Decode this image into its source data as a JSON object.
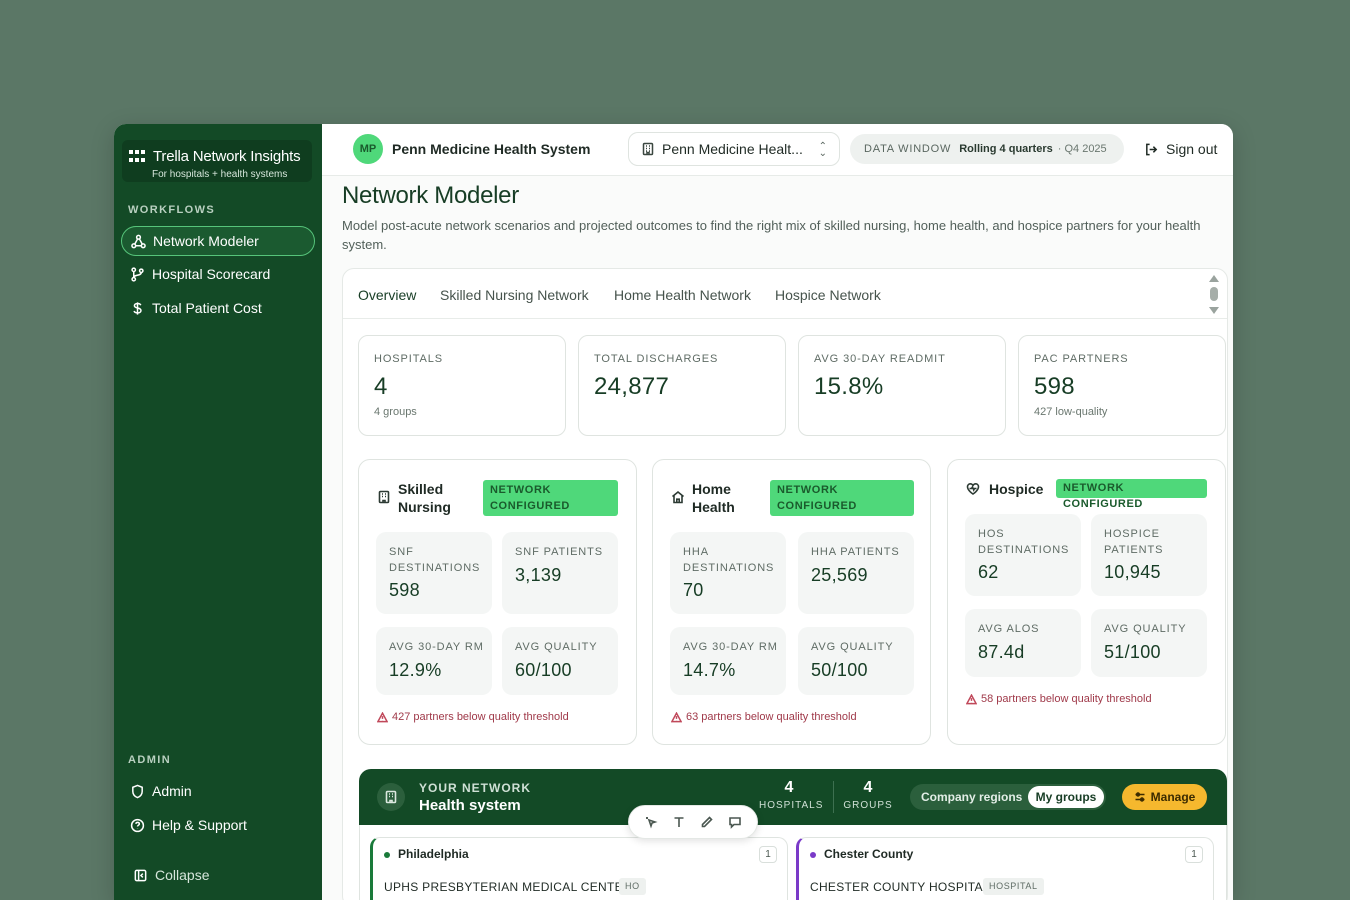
{
  "app": {
    "brand_title": "Trella Network Insights",
    "brand_subtitle": "For hospitals + health systems"
  },
  "sidebar": {
    "workflows_label": "WORKFLOWS",
    "items": [
      {
        "label": "Network Modeler",
        "icon": "network-icon",
        "active": true
      },
      {
        "label": "Hospital Scorecard",
        "icon": "branch-icon",
        "active": false
      },
      {
        "label": "Total Patient Cost",
        "icon": "dollar-icon",
        "active": false
      }
    ],
    "admin_label": "ADMIN",
    "admin_items": [
      {
        "label": "Admin",
        "icon": "shield-icon"
      },
      {
        "label": "Help & Support",
        "icon": "help-icon"
      }
    ],
    "collapse_label": "Collapse"
  },
  "header": {
    "avatar_initials": "MP",
    "org_name": "Penn Medicine Health System",
    "org_select_value": "Penn Medicine Healt...",
    "data_window_label": "DATA WINDOW",
    "data_window_value": "Rolling 4 quarters",
    "data_window_quarter": "· Q4 2025",
    "signout_label": "Sign out"
  },
  "page": {
    "title": "Network Modeler",
    "description": "Model post-acute network scenarios and projected outcomes to find the right mix of skilled nursing, home health, and hospice partners for your health system."
  },
  "tabs": [
    "Overview",
    "Skilled Nursing Network",
    "Home Health Network",
    "Hospice Network"
  ],
  "kpis": [
    {
      "label": "HOSPITALS",
      "value": "4",
      "sub": "4 groups"
    },
    {
      "label": "TOTAL DISCHARGES",
      "value": "24,877",
      "sub": ""
    },
    {
      "label": "AVG 30-DAY READMIT",
      "value": "15.8%",
      "sub": ""
    },
    {
      "label": "PAC PARTNERS",
      "value": "598",
      "sub": "427 low-quality"
    }
  ],
  "networks": [
    {
      "title": "Skilled Nursing",
      "badge": "NETWORK CONFIGURED",
      "stats": [
        {
          "label": "SNF DESTINATIONS",
          "value": "598"
        },
        {
          "label": "SNF PATIENTS",
          "value": "3,139"
        },
        {
          "label": "AVG 30-DAY RM",
          "value": "12.9%"
        },
        {
          "label": "AVG QUALITY",
          "value": "60/100"
        }
      ],
      "warning": "427 partners below quality threshold"
    },
    {
      "title": "Home Health",
      "badge": "NETWORK CONFIGURED",
      "stats": [
        {
          "label": "HHA DESTINATIONS",
          "value": "70"
        },
        {
          "label": "HHA PATIENTS",
          "value": "25,569"
        },
        {
          "label": "AVG 30-DAY RM",
          "value": "14.7%"
        },
        {
          "label": "AVG QUALITY",
          "value": "50/100"
        }
      ],
      "warning": "63 partners below quality threshold"
    },
    {
      "title": "Hospice",
      "badge": "NETWORK CONFIGURED",
      "stats": [
        {
          "label": "HOS DESTINATIONS",
          "value": "62"
        },
        {
          "label": "HOSPICE PATIENTS",
          "value": "10,945"
        },
        {
          "label": "AVG ALOS",
          "value": "87.4d"
        },
        {
          "label": "AVG QUALITY",
          "value": "51/100"
        }
      ],
      "warning": "58 partners below quality threshold"
    }
  ],
  "your_network": {
    "label": "YOUR NETWORK",
    "title": "Health system",
    "hospitals_count": "4",
    "hospitals_label": "HOSPITALS",
    "groups_count": "4",
    "groups_label": "GROUPS",
    "seg_off": "Company regions",
    "seg_on": "My groups",
    "manage_label": "Manage",
    "regions": [
      {
        "name": "Philadelphia",
        "count": "1",
        "hospital": "UPHS PRESBYTERIAN MEDICAL CENTER",
        "tag": "HO",
        "color": "#1a7a3a"
      },
      {
        "name": "Chester County",
        "count": "1",
        "hospital": "CHESTER COUNTY HOSPITAL",
        "tag": "HOSPITAL",
        "color": "#7a3ac8"
      }
    ]
  },
  "colors": {
    "sidebar_bg": "#134a26",
    "accent_green": "#4fd87a",
    "manage_yellow": "#f5b82e",
    "warning_red": "#a03a4a"
  }
}
